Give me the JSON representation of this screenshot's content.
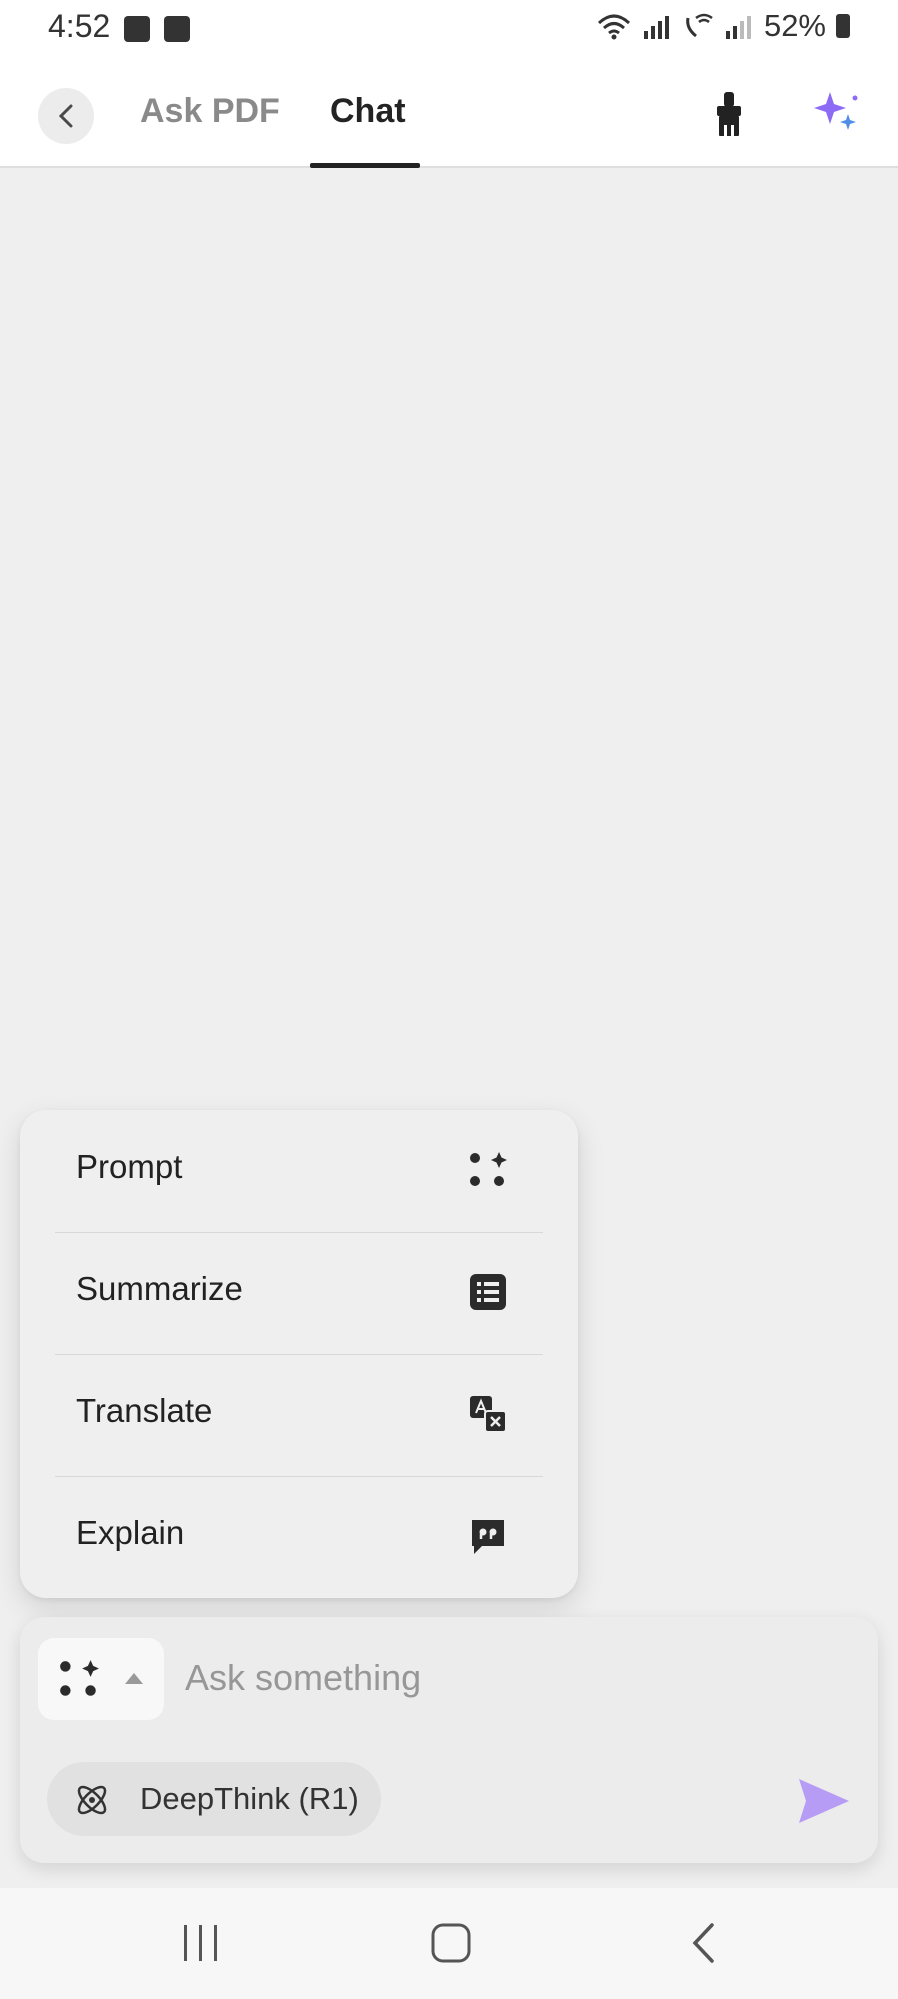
{
  "status_bar": {
    "time": "4:52",
    "battery": "52%"
  },
  "header": {
    "tabs": [
      {
        "label": "Ask PDF",
        "active": false
      },
      {
        "label": "Chat",
        "active": true
      }
    ],
    "icons": {
      "back": "chevron-left-icon",
      "clean": "brush-icon",
      "ai": "sparkle-icon"
    }
  },
  "menu": {
    "items": [
      {
        "label": "Prompt",
        "icon": "prompt-dots-icon"
      },
      {
        "label": "Summarize",
        "icon": "list-icon"
      },
      {
        "label": "Translate",
        "icon": "translate-icon"
      },
      {
        "label": "Explain",
        "icon": "explain-icon"
      }
    ]
  },
  "composer": {
    "placeholder": "Ask something",
    "deepthink_label": "DeepThink (R1)",
    "send_icon": "send-icon"
  },
  "colors": {
    "accent": "#b79cf5",
    "background": "#efefef",
    "sparkle_purple": "#8d6bf5",
    "sparkle_blue": "#4e8ee8"
  }
}
